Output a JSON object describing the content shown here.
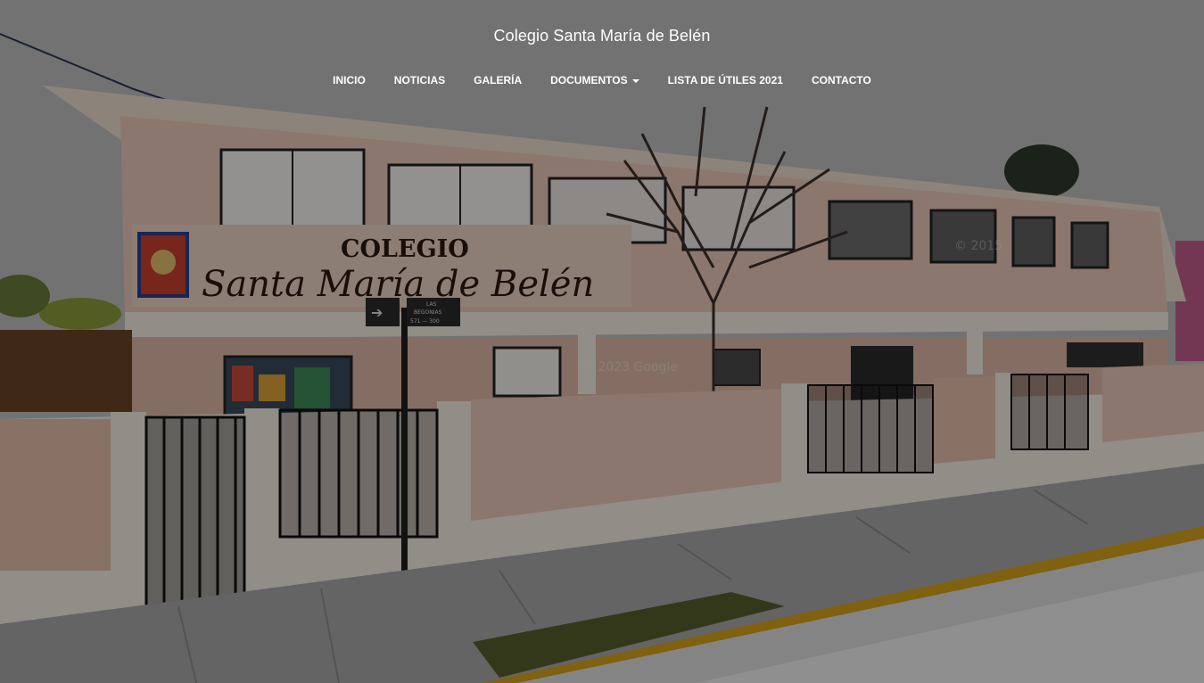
{
  "site": {
    "title": "Colegio Santa María de Belén"
  },
  "nav": {
    "items": [
      {
        "label": "INICIO"
      },
      {
        "label": "NOTICIAS"
      },
      {
        "label": "GALERÍA"
      },
      {
        "label": "DOCUMENTOS",
        "has_dropdown": true
      },
      {
        "label": "LISTA DE ÚTILES 2021"
      },
      {
        "label": "CONTACTO"
      }
    ]
  },
  "hero": {
    "sign_line1": "COLEGIO",
    "sign_line2": "Santa María de Belén",
    "street_sign_line1": "LAS",
    "street_sign_line2": "BEGONIAS",
    "street_sign_line3": "571 — 300",
    "watermark1": "© 2015",
    "watermark2": "© 2023 Google",
    "colors": {
      "overlay": "#000000",
      "wall": "#e8c6b6",
      "trim": "#f0e8dc",
      "sky": "#bdbdbd",
      "curb": "#d4a21a"
    }
  }
}
